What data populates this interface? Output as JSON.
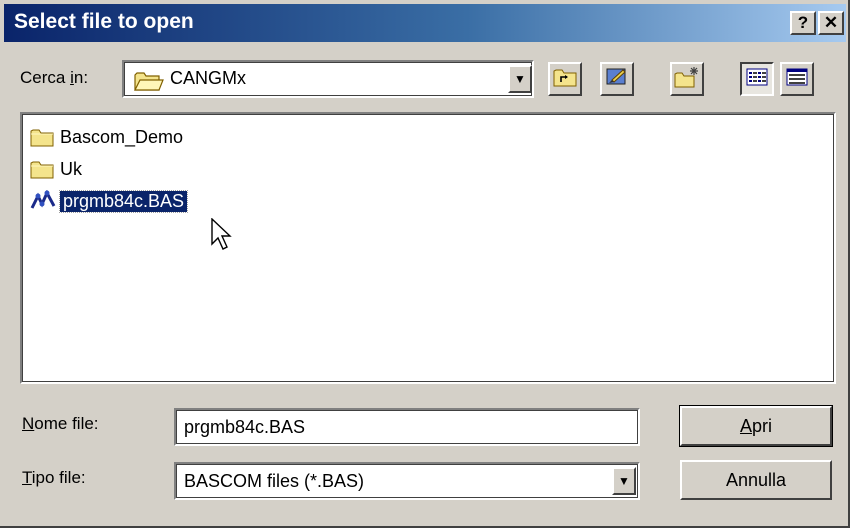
{
  "window": {
    "title": "Select file to open",
    "help_label": "?",
    "close_label": "✕"
  },
  "look_in": {
    "label_prefix": "Cerca ",
    "label_accel": "i",
    "label_suffix": "n:",
    "value": "CANGMx",
    "dropdown_glyph": "▼"
  },
  "toolbar": {
    "icons": [
      "up-one-level-icon",
      "desktop-icon",
      "new-folder-icon",
      "list-view-icon",
      "details-view-icon"
    ]
  },
  "files": [
    {
      "name": "Bascom_Demo",
      "type": "folder",
      "selected": false
    },
    {
      "name": "Uk",
      "type": "folder",
      "selected": false
    },
    {
      "name": "prgmb84c.BAS",
      "type": "bas-file",
      "selected": true
    }
  ],
  "file_name": {
    "label_accel": "N",
    "label_rest": "ome file:",
    "value": "prgmb84c.BAS"
  },
  "file_type": {
    "label_accel": "T",
    "label_rest": "ipo file:",
    "value": "BASCOM files (*.BAS)",
    "dropdown_glyph": "▼"
  },
  "buttons": {
    "open_accel": "A",
    "open_rest": "pri",
    "cancel": "Annulla"
  },
  "colors": {
    "title_start": "#0a246a",
    "title_end": "#a6caf0",
    "face": "#d4d0c8",
    "selection": "#0a246a"
  }
}
